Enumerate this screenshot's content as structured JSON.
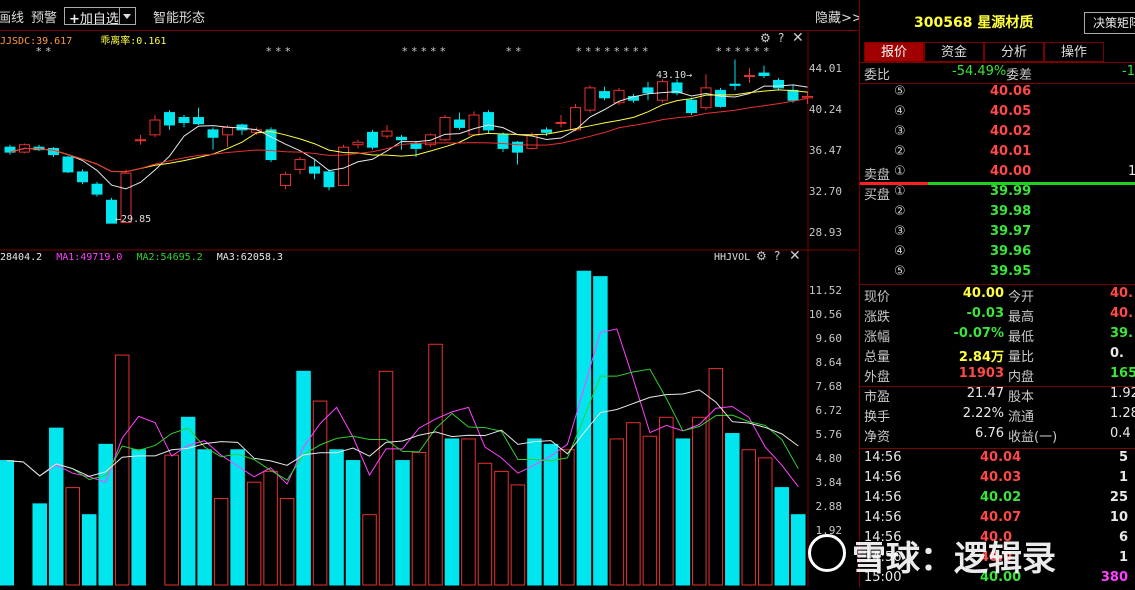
{
  "toolbar": {
    "items": [
      "画线",
      "预警",
      "加自选",
      "智能形态"
    ],
    "hide_label": "隐藏>>"
  },
  "price_panel": {
    "indicator": "JJSDC:39.617",
    "indicator2": "乖离率:0.161",
    "ticks": [
      "44.01",
      "40.24",
      "36.47",
      "32.70",
      "28.93"
    ],
    "high_marker": "43.10",
    "low_marker": "29.85"
  },
  "vol_panel": {
    "legend": [
      "28404.2",
      "MA1:49719.0",
      "MA2:54695.2",
      "MA3:62058.3"
    ],
    "name": "HHJVOL",
    "ticks": [
      "11.52",
      "10.56",
      "9.60",
      "8.64",
      "7.68",
      "6.72",
      "5.76",
      "4.80",
      "3.84",
      "2.88",
      "1.92"
    ]
  },
  "colors": {
    "up": "#e83030",
    "down": "#00e5ee",
    "ma_white": "#e8e8e8",
    "ma_yellow": "#ffff40",
    "ma_red": "#e83030",
    "ma_magenta": "#ff40ff",
    "ma_green": "#30d030"
  },
  "chart_data": {
    "type": "candlestick",
    "candles": [
      {
        "o": 36.0,
        "c": 35.6,
        "h": 36.2,
        "l": 35.4
      },
      {
        "o": 35.6,
        "c": 36.2,
        "h": 36.3,
        "l": 35.5
      },
      {
        "o": 36.0,
        "c": 35.8,
        "h": 36.2,
        "l": 35.7
      },
      {
        "o": 35.9,
        "c": 35.4,
        "h": 36.0,
        "l": 35.2
      },
      {
        "o": 35.2,
        "c": 34.0,
        "h": 35.3,
        "l": 33.9
      },
      {
        "o": 34.0,
        "c": 33.2,
        "h": 34.2,
        "l": 33.0
      },
      {
        "o": 33.0,
        "c": 32.2,
        "h": 33.2,
        "l": 32.0
      },
      {
        "o": 31.7,
        "c": 29.85,
        "h": 31.9,
        "l": 29.85
      },
      {
        "o": 29.9,
        "c": 33.9,
        "h": 34.2,
        "l": 29.9
      },
      {
        "o": 36.6,
        "c": 36.6,
        "h": 37.0,
        "l": 36.2
      },
      {
        "o": 37.0,
        "c": 38.2,
        "h": 38.6,
        "l": 36.8
      },
      {
        "o": 38.8,
        "c": 37.8,
        "h": 39.0,
        "l": 37.4
      },
      {
        "o": 38.4,
        "c": 38.0,
        "h": 38.6,
        "l": 37.6
      },
      {
        "o": 38.4,
        "c": 37.9,
        "h": 39.2,
        "l": 37.8
      },
      {
        "o": 37.4,
        "c": 36.8,
        "h": 37.6,
        "l": 35.8
      },
      {
        "o": 37.0,
        "c": 37.6,
        "h": 37.8,
        "l": 36.0
      },
      {
        "o": 37.8,
        "c": 37.4,
        "h": 37.9,
        "l": 37.0
      },
      {
        "o": 37.2,
        "c": 37.4,
        "h": 37.6,
        "l": 37.0
      },
      {
        "o": 37.4,
        "c": 35.0,
        "h": 37.6,
        "l": 34.8
      },
      {
        "o": 32.9,
        "c": 33.8,
        "h": 34.0,
        "l": 32.6
      },
      {
        "o": 34.2,
        "c": 35.0,
        "h": 35.2,
        "l": 33.8
      },
      {
        "o": 34.4,
        "c": 33.9,
        "h": 35.0,
        "l": 33.4
      },
      {
        "o": 34.0,
        "c": 32.8,
        "h": 34.2,
        "l": 32.5
      },
      {
        "o": 32.9,
        "c": 36.0,
        "h": 36.2,
        "l": 32.9
      },
      {
        "o": 36.2,
        "c": 36.4,
        "h": 36.6,
        "l": 35.9
      },
      {
        "o": 37.2,
        "c": 36.0,
        "h": 37.4,
        "l": 35.8
      },
      {
        "o": 36.9,
        "c": 37.3,
        "h": 37.8,
        "l": 36.7
      },
      {
        "o": 36.8,
        "c": 36.6,
        "h": 37.0,
        "l": 35.8
      },
      {
        "o": 36.3,
        "c": 35.9,
        "h": 36.5,
        "l": 35.2
      },
      {
        "o": 36.2,
        "c": 37.0,
        "h": 37.1,
        "l": 36.0
      },
      {
        "o": 36.6,
        "c": 38.4,
        "h": 38.6,
        "l": 36.5
      },
      {
        "o": 38.2,
        "c": 37.6,
        "h": 38.8,
        "l": 37.4
      },
      {
        "o": 37.0,
        "c": 38.6,
        "h": 38.9,
        "l": 36.9
      },
      {
        "o": 38.8,
        "c": 37.4,
        "h": 39.0,
        "l": 37.1
      },
      {
        "o": 37.0,
        "c": 35.9,
        "h": 37.2,
        "l": 35.6
      },
      {
        "o": 36.4,
        "c": 35.6,
        "h": 36.5,
        "l": 34.6
      },
      {
        "o": 35.9,
        "c": 37.0,
        "h": 37.2,
        "l": 35.8
      },
      {
        "o": 37.4,
        "c": 37.2,
        "h": 37.6,
        "l": 36.9
      },
      {
        "o": 38.0,
        "c": 38.0,
        "h": 38.6,
        "l": 37.6
      },
      {
        "o": 37.4,
        "c": 39.2,
        "h": 39.5,
        "l": 37.3
      },
      {
        "o": 39.0,
        "c": 40.8,
        "h": 41.0,
        "l": 38.8
      },
      {
        "o": 40.5,
        "c": 40.0,
        "h": 40.9,
        "l": 39.8
      },
      {
        "o": 39.6,
        "c": 40.6,
        "h": 40.8,
        "l": 39.4
      },
      {
        "o": 40.1,
        "c": 39.8,
        "h": 40.3,
        "l": 39.6
      },
      {
        "o": 40.8,
        "c": 40.4,
        "h": 41.3,
        "l": 39.8
      },
      {
        "o": 39.8,
        "c": 41.3,
        "h": 41.5,
        "l": 39.6
      },
      {
        "o": 41.2,
        "c": 40.4,
        "h": 41.5,
        "l": 40.2
      },
      {
        "o": 39.8,
        "c": 38.8,
        "h": 40.0,
        "l": 38.6
      },
      {
        "o": 39.2,
        "c": 40.8,
        "h": 41.9,
        "l": 39.0
      },
      {
        "o": 40.6,
        "c": 39.3,
        "h": 40.8,
        "l": 39.2
      },
      {
        "o": 41.1,
        "c": 41.0,
        "h": 43.1,
        "l": 40.6
      },
      {
        "o": 41.8,
        "c": 41.8,
        "h": 42.4,
        "l": 41.2
      },
      {
        "o": 42.0,
        "c": 41.8,
        "h": 42.6,
        "l": 41.6
      },
      {
        "o": 41.4,
        "c": 40.8,
        "h": 41.6,
        "l": 40.6
      },
      {
        "o": 40.6,
        "c": 39.8,
        "h": 41.0,
        "l": 39.6
      },
      {
        "o": 40.0,
        "c": 40.1,
        "h": 40.5,
        "l": 39.5
      }
    ],
    "ylim": [
      28.0,
      45.0
    ],
    "volume": [
      4.6,
      0.0,
      3.0,
      5.8,
      3.6,
      2.6,
      5.2,
      8.5,
      5.0,
      0.0,
      4.8,
      6.2,
      5.0,
      3.2,
      5.0,
      3.8,
      4.2,
      3.2,
      7.9,
      6.8,
      5.0,
      4.6,
      2.6,
      7.9,
      4.6,
      4.9,
      8.9,
      5.4,
      5.4,
      4.5,
      4.2,
      3.7,
      5.4,
      5.2,
      5.0,
      11.6,
      11.4,
      5.4,
      6.0,
      5.5,
      6.2,
      5.4,
      6.2,
      8.0,
      5.6,
      5.0,
      4.7,
      3.6,
      2.6
    ],
    "volume_ylim": [
      0.0,
      12.2
    ]
  },
  "right": {
    "code": "300568",
    "name": "星源材质",
    "decision_btn": "决策矩阵",
    "tabs": [
      "报价",
      "资金",
      "分析",
      "操作"
    ],
    "weibi_label": "委比",
    "weibi": "-54.49%",
    "weicha_label": "委差",
    "weicha": "-1",
    "sell_label": "卖盘",
    "buy_label": "买盘",
    "asks": [
      {
        "n": "⑤",
        "price": "40.06"
      },
      {
        "n": "④",
        "price": "40.05"
      },
      {
        "n": "③",
        "price": "40.02"
      },
      {
        "n": "②",
        "price": "40.01"
      },
      {
        "n": "①",
        "price": "40.00",
        "qty": "1"
      }
    ],
    "bids": [
      {
        "n": "①",
        "price": "39.99"
      },
      {
        "n": "②",
        "price": "39.98"
      },
      {
        "n": "③",
        "price": "39.97"
      },
      {
        "n": "④",
        "price": "39.96"
      },
      {
        "n": "⑤",
        "price": "39.95"
      }
    ],
    "quote": [
      {
        "l": "现价",
        "v": "40.00",
        "l2": "今开",
        "v2": "40."
      },
      {
        "l": "涨跌",
        "v": "-0.03",
        "l2": "最高",
        "v2": "40."
      },
      {
        "l": "涨幅",
        "v": "-0.07%",
        "l2": "最低",
        "v2": "39."
      },
      {
        "l": "总量",
        "v": "2.84万",
        "l2": "量比",
        "v2": "0."
      },
      {
        "l": "外盘",
        "v": "11903",
        "l2": "内盘",
        "v2": "165"
      }
    ],
    "fin": [
      {
        "l": "市盈",
        "v": "21.47",
        "l2": "股本",
        "v2": "1.92"
      },
      {
        "l": "换手",
        "v": "2.22%",
        "l2": "流通",
        "v2": "1.28"
      },
      {
        "l": "净资",
        "v": "6.76",
        "l2": "收益(一)",
        "v2": "0.4"
      }
    ],
    "ticks": [
      {
        "t": "14:56",
        "p": "40.04",
        "q": "5"
      },
      {
        "t": "14:56",
        "p": "40.03",
        "q": "1"
      },
      {
        "t": "14:56",
        "p": "40.02",
        "q": "25"
      },
      {
        "t": "14:56",
        "p": "40.07",
        "q": "10"
      },
      {
        "t": "14:56",
        "p": "40.0",
        "q": "6"
      },
      {
        "t": "14:56",
        "p": "40.0",
        "q": "1"
      },
      {
        "t": "15:00",
        "p": "40.00",
        "q": "380"
      }
    ]
  },
  "watermark": "雪球：逻辑录"
}
